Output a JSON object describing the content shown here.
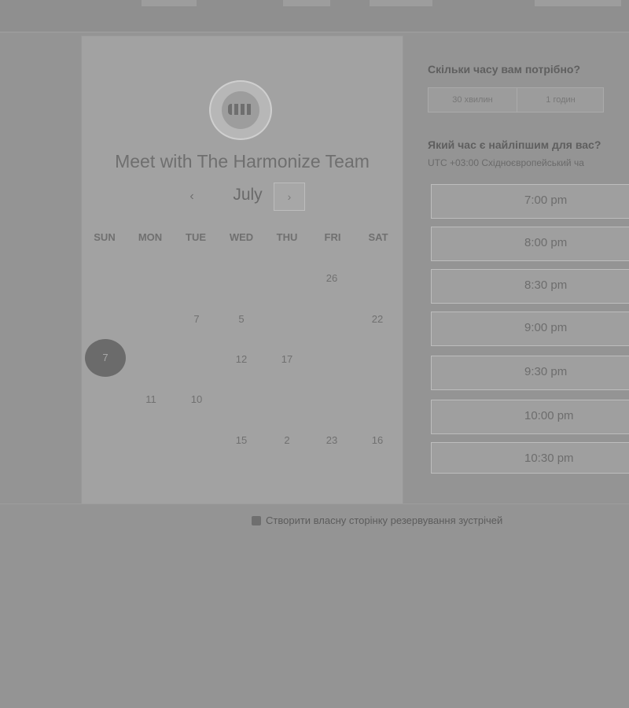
{
  "scheduler": {
    "title": "Meet with The Harmonize Team",
    "month": "July",
    "nav": {
      "prev": "‹",
      "next": "›"
    },
    "weekdays": [
      "SUN",
      "MON",
      "TUE",
      "WED",
      "THU",
      "FRI",
      "SAT"
    ],
    "days": {
      "fri_26": "26",
      "tue_7": "7",
      "wed_5": "5",
      "sat_22": "22",
      "selected_7": "7",
      "wed_12": "12",
      "thu_17": "17",
      "mon_11": "11",
      "tue_10": "10",
      "wed_15": "15",
      "thu_2": "2",
      "fri_23": "23",
      "sat_16": "16"
    }
  },
  "booking": {
    "duration_question": "Скільки часу вам потрібно?",
    "duration_options": [
      "30 хвилин",
      "1 годин"
    ],
    "time_question": "Який час є найліпшим для вас?",
    "timezone": "UTC +03:00 Східноєвропейський ча",
    "slots": [
      "7:00 pm",
      "8:00 pm",
      "8:30 pm",
      "9:00 pm",
      "9:30 pm",
      "10:00 pm",
      "10:30 pm"
    ]
  },
  "footer": {
    "create_link": "Створити власну сторінку резервування зустрічей"
  }
}
